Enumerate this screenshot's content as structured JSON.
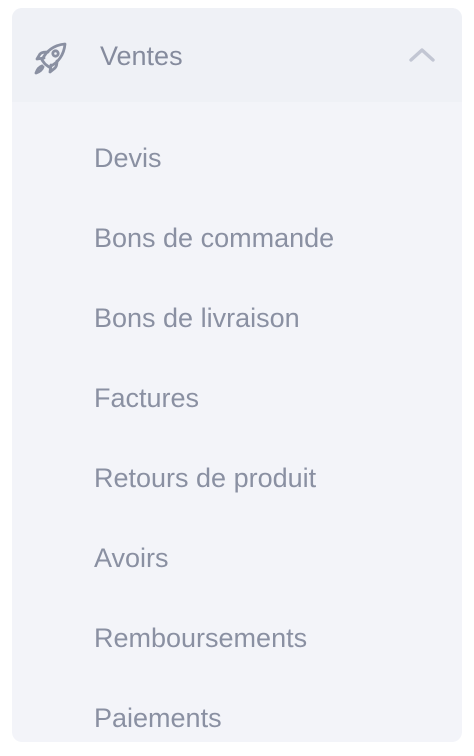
{
  "menu": {
    "section": {
      "title": "Ventes",
      "icon": "rocket-icon",
      "expand_icon": "chevron-up-icon"
    },
    "items": [
      {
        "label": "Devis"
      },
      {
        "label": "Bons de commande"
      },
      {
        "label": "Bons de livraison"
      },
      {
        "label": "Factures"
      },
      {
        "label": "Retours de produit"
      },
      {
        "label": "Avoirs"
      },
      {
        "label": "Remboursements"
      },
      {
        "label": "Paiements"
      }
    ]
  },
  "colors": {
    "panel_background": "#f3f4f9",
    "header_background": "#eff1f6",
    "text": "#8a90a2",
    "icon": "#8a90a2"
  }
}
